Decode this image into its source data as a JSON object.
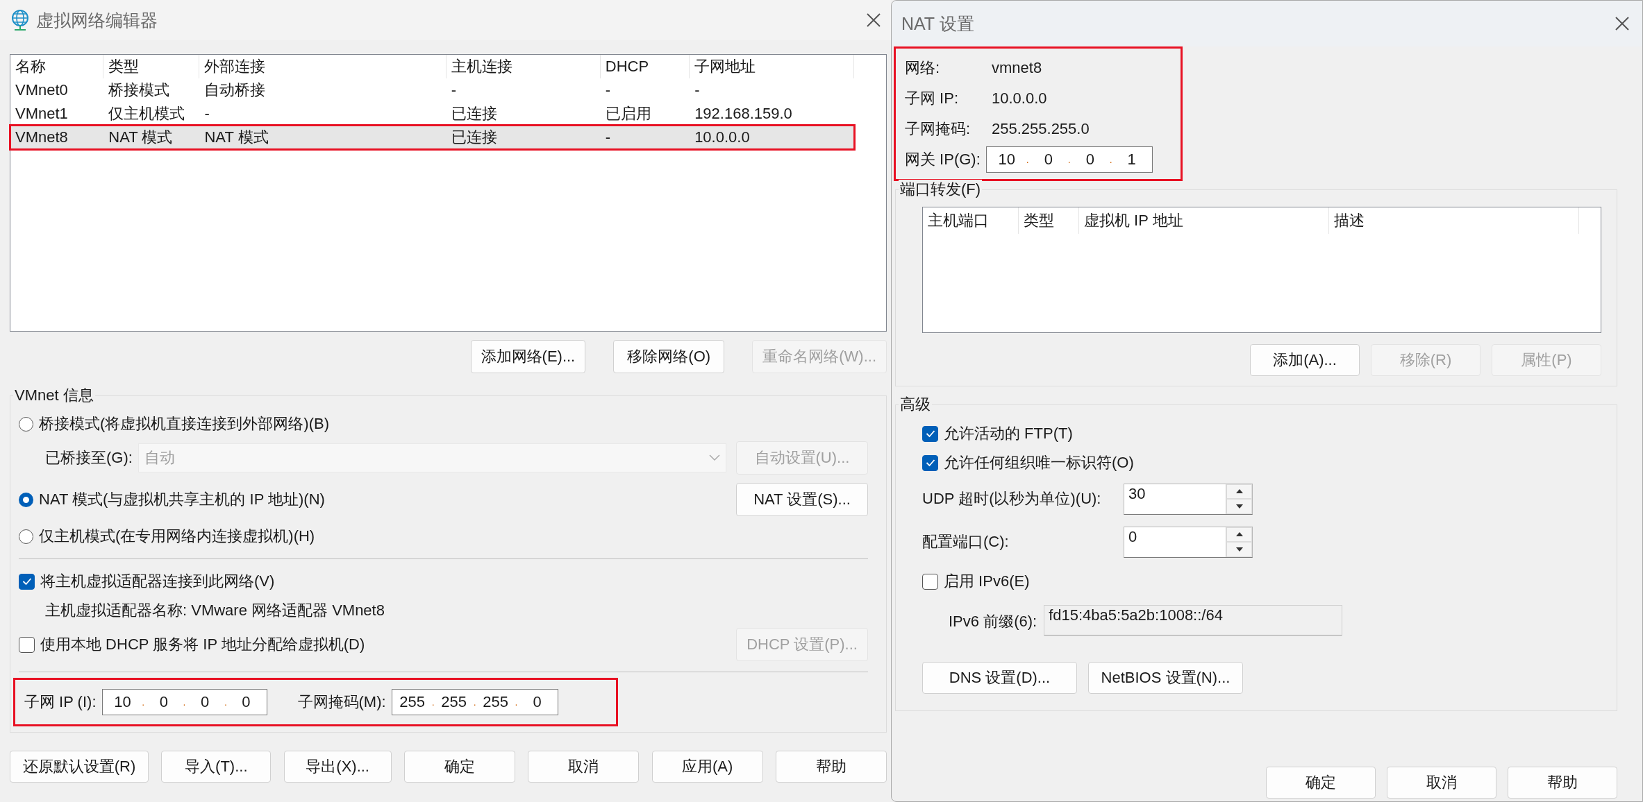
{
  "editor": {
    "title": "虚拟网络编辑器",
    "table": {
      "columns": [
        "名称",
        "类型",
        "外部连接",
        "主机连接",
        "DHCP",
        "子网地址"
      ],
      "rows": [
        {
          "cells": [
            "VMnet0",
            "桥接模式",
            "自动桥接",
            "-",
            "-",
            "-"
          ],
          "selected": false,
          "highlighted": false
        },
        {
          "cells": [
            "VMnet1",
            "仅主机模式",
            "-",
            "已连接",
            "已启用",
            "192.168.159.0"
          ],
          "selected": false,
          "highlighted": false
        },
        {
          "cells": [
            "VMnet8",
            "NAT 模式",
            "NAT 模式",
            "已连接",
            "-",
            "10.0.0.0"
          ],
          "selected": true,
          "highlighted": true
        }
      ]
    },
    "table_buttons": [
      {
        "label": "添加网络(E)...",
        "disabled": false
      },
      {
        "label": "移除网络(O)",
        "disabled": false
      },
      {
        "label": "重命名网络(W)...",
        "disabled": true
      }
    ],
    "vmnet_info": {
      "title": "VMnet 信息",
      "modes": [
        {
          "label": "桥接模式(将虚拟机直接连接到外部网络)(B)",
          "selected": false
        },
        {
          "label": "NAT 模式(与虚拟机共享主机的 IP 地址)(N)",
          "selected": true
        },
        {
          "label": "仅主机模式(在专用网络内连接虚拟机)(H)",
          "selected": false
        }
      ],
      "bridged_to": {
        "label": "已桥接至(G):",
        "value": "自动",
        "disabled": true
      },
      "auto_button": {
        "label": "自动设置(U)...",
        "disabled": true
      },
      "nat_button": {
        "label": "NAT 设置(S)...",
        "disabled": false
      },
      "connect_adapter": {
        "label": "将主机虚拟适配器连接到此网络(V)",
        "checked": true
      },
      "adapter_name": "主机虚拟适配器名称: VMware 网络适配器 VMnet8",
      "use_dhcp": {
        "label": "使用本地 DHCP 服务将 IP 地址分配给虚拟机(D)",
        "checked": false
      },
      "dhcp_button": {
        "label": "DHCP 设置(P)...",
        "disabled": true
      },
      "subnet": {
        "highlighted": true,
        "ip_label": "子网 IP (I):",
        "ip": [
          "10",
          "0",
          "0",
          "0"
        ],
        "mask_label": "子网掩码(M):",
        "mask": [
          "255",
          "255",
          "255",
          "0"
        ],
        "separator": "."
      }
    },
    "buttons": [
      {
        "label": "还原默认设置(R)",
        "disabled": false
      },
      {
        "label": "导入(T)...",
        "disabled": false
      },
      {
        "label": "导出(X)...",
        "disabled": false
      },
      {
        "label": "确定",
        "disabled": false
      },
      {
        "label": "取消",
        "disabled": false
      },
      {
        "label": "应用(A)",
        "disabled": false
      },
      {
        "label": "帮助",
        "disabled": false
      }
    ]
  },
  "nat": {
    "title": "NAT 设置",
    "info": {
      "highlighted": true,
      "rows": [
        {
          "label": "网络:",
          "value": "vmnet8"
        },
        {
          "label": "子网 IP:",
          "value": "10.0.0.0"
        },
        {
          "label": "子网掩码:",
          "value": "255.255.255.0"
        }
      ],
      "gateway": {
        "label": "网关 IP(G):",
        "octets": [
          "10",
          "0",
          "0",
          "1"
        ],
        "separator": "."
      }
    },
    "port_forwarding": {
      "title": "端口转发(F)",
      "columns": [
        "主机端口",
        "类型",
        "虚拟机 IP 地址",
        "描述"
      ],
      "buttons": [
        {
          "label": "添加(A)...",
          "disabled": false
        },
        {
          "label": "移除(R)",
          "disabled": true
        },
        {
          "label": "属性(P)",
          "disabled": true
        }
      ]
    },
    "advanced": {
      "title": "高级",
      "options": [
        {
          "label": "允许活动的 FTP(T)",
          "checked": true
        },
        {
          "label": "允许任何组织唯一标识符(O)",
          "checked": true
        }
      ],
      "spinners": [
        {
          "label": "UDP 超时(以秒为单位)(U):",
          "value": "30"
        },
        {
          "label": "配置端口(C):",
          "value": "0"
        }
      ],
      "ipv6": {
        "label": "启用 IPv6(E)",
        "checked": false
      },
      "prefix": {
        "label": "IPv6 前缀(6):",
        "value": "fd15:4ba5:5a2b:1008::/64"
      },
      "buttons": [
        {
          "label": "DNS 设置(D)...",
          "disabled": false
        },
        {
          "label": "NetBIOS 设置(N)...",
          "disabled": false
        }
      ]
    },
    "buttons": [
      {
        "label": "确定",
        "disabled": false
      },
      {
        "label": "取消",
        "disabled": false
      },
      {
        "label": "帮助",
        "disabled": false
      }
    ]
  }
}
